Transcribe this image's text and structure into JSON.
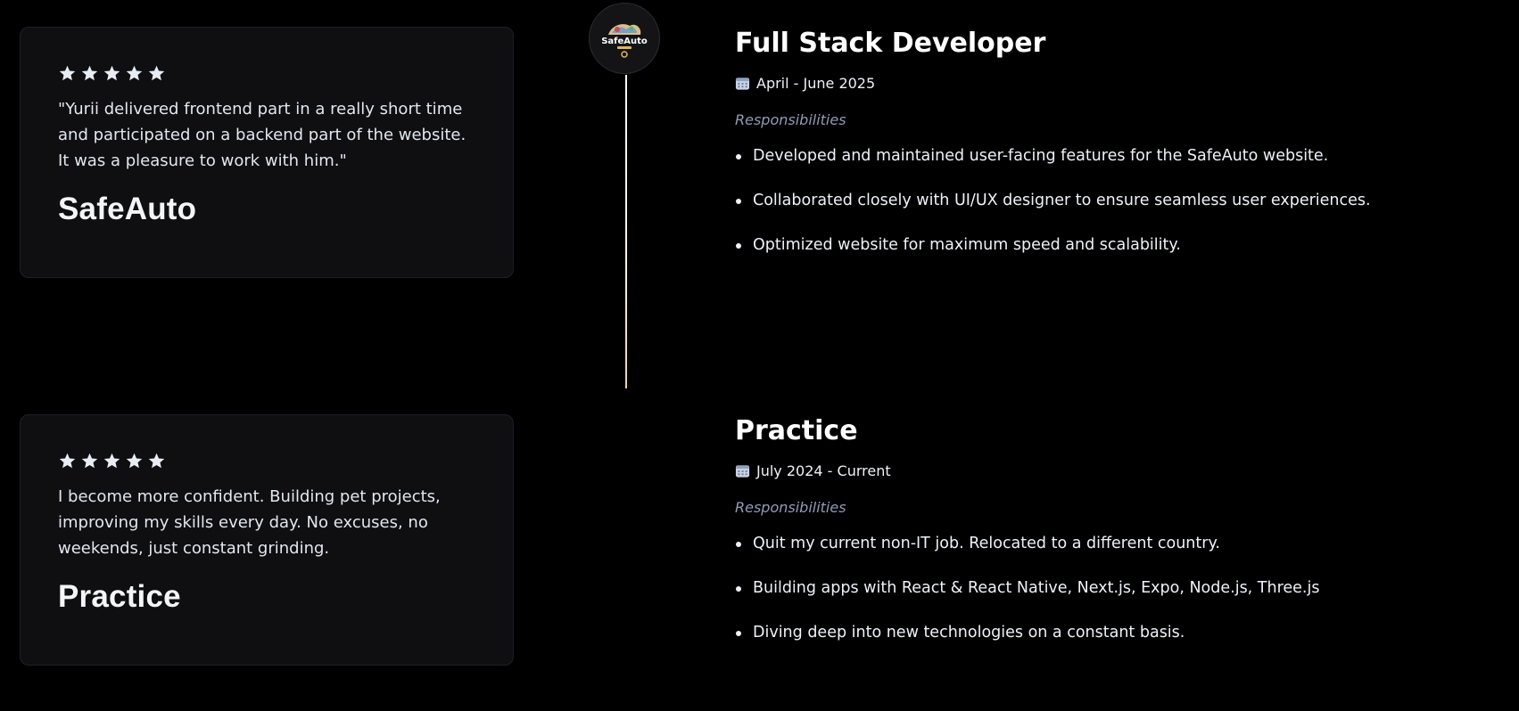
{
  "colors": {
    "background": "#000000",
    "card_background": "#0f0f11",
    "responsibilities_label": "#8f9bb8",
    "timeline_gradient_end": "#f6d27a"
  },
  "testimonials": [
    {
      "rating": 5,
      "quote": "\"Yurii delivered frontend part in a really short time and participated on a backend part of the website. It was a pleasure to work with him.\"",
      "name": "SafeAuto"
    },
    {
      "rating": 5,
      "quote": "I become more confident. Building pet projects, improving my skills every day. No excuses, no weekends, just constant grinding.",
      "name": "Practice"
    }
  ],
  "timeline": {
    "logo_icon": "safeauto-logo-icon",
    "logo_text": "SafeAuto"
  },
  "experience": [
    {
      "title": "Full Stack Developer",
      "date": "April - June 2025",
      "responsibilities_label": "Responsibilities",
      "responsibilities": [
        "Developed and maintained user-facing features for the SafeAuto website.",
        "Collaborated closely with UI/UX designer to ensure seamless user experiences.",
        "Optimized website for maximum speed and scalability."
      ]
    },
    {
      "title": "Practice",
      "date": "July 2024 - Current",
      "responsibilities_label": "Responsibilities",
      "responsibilities": [
        "Quit my current non-IT job. Relocated to a different country.",
        "Building apps with React & React Native, Next.js, Expo, Node.js, Three.js",
        "Diving deep into new technologies on a constant basis."
      ]
    }
  ]
}
